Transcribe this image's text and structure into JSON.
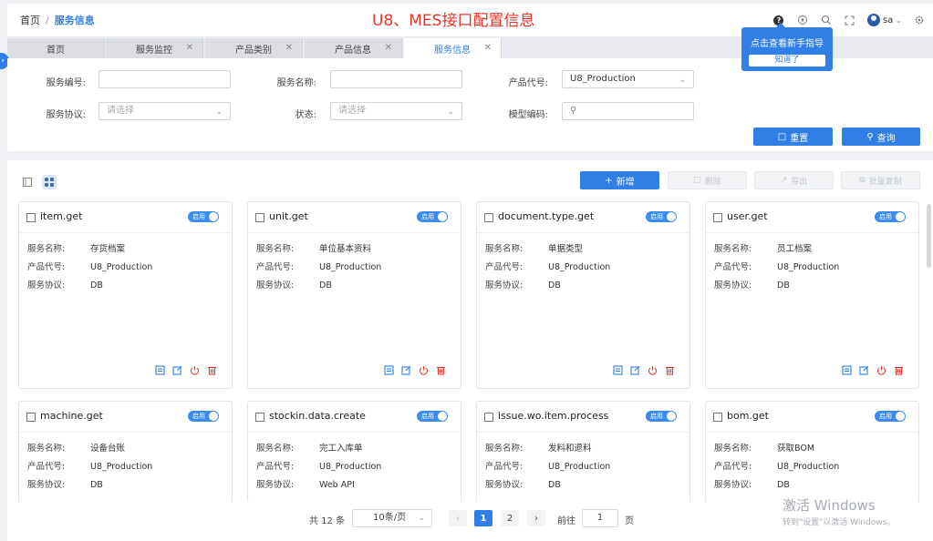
{
  "breadcrumb": {
    "home": "首页",
    "separator": "/",
    "current": "服务信息"
  },
  "page_title": "U8、MES接口配置信息",
  "toolbar": {
    "user": "sa"
  },
  "tooltip": {
    "text": "点击查看新手指导",
    "button": "知道了"
  },
  "tabs": [
    {
      "label": "首页",
      "closable": false
    },
    {
      "label": "服务监控",
      "closable": true
    },
    {
      "label": "产品类别",
      "closable": true
    },
    {
      "label": "产品信息",
      "closable": true
    },
    {
      "label": "服务信息",
      "closable": true,
      "active": true
    }
  ],
  "filters": {
    "service_code": {
      "label": "服务编号:",
      "value": ""
    },
    "service_name": {
      "label": "服务名称:",
      "value": ""
    },
    "product_code": {
      "label": "产品代号:",
      "value": "U8_Production"
    },
    "service_protocol": {
      "label": "服务协议:",
      "placeholder": "请选择"
    },
    "status": {
      "label": "状态:",
      "placeholder": "请选择"
    },
    "model_code": {
      "label": "模型编码:",
      "value": ""
    },
    "reset_label": "重置",
    "query_label": "查询"
  },
  "actions": {
    "add": "新增",
    "delete": "删除",
    "export": "导出",
    "batch_copy": "批量复制"
  },
  "field_labels": {
    "name": "服务名称:",
    "product": "产品代号:",
    "protocol": "服务协议:"
  },
  "switch_label": "启用",
  "cards": [
    {
      "title": "item.get",
      "name": "存货档案",
      "product": "U8_Production",
      "protocol": "DB"
    },
    {
      "title": "unit.get",
      "name": "单位基本资料",
      "product": "U8_Production",
      "protocol": "DB"
    },
    {
      "title": "document.type.get",
      "name": "单据类型",
      "product": "U8_Production",
      "protocol": "DB"
    },
    {
      "title": "user.get",
      "name": "员工档案",
      "product": "U8_Production",
      "protocol": "DB"
    },
    {
      "title": "machine.get",
      "name": "设备台账",
      "product": "U8_Production",
      "protocol": "DB"
    },
    {
      "title": "stockin.data.create",
      "name": "完工入库单",
      "product": "U8_Production",
      "protocol": "Web API"
    },
    {
      "title": "issue.wo.item.process",
      "name": "发料和退料",
      "product": "U8_Production",
      "protocol": "DB"
    },
    {
      "title": "bom.get",
      "name": "获取BOM",
      "product": "U8_Production",
      "protocol": "DB"
    }
  ],
  "pagination": {
    "total": "共 12 条",
    "page_size": "10条/页",
    "pages": [
      "1",
      "2"
    ],
    "current_page": "1",
    "goto_label": "前往",
    "goto_value": "1",
    "page_unit": "页"
  },
  "watermark": {
    "line1": "激活 Windows",
    "line2": "转到\"设置\"以激活 Windows。"
  }
}
